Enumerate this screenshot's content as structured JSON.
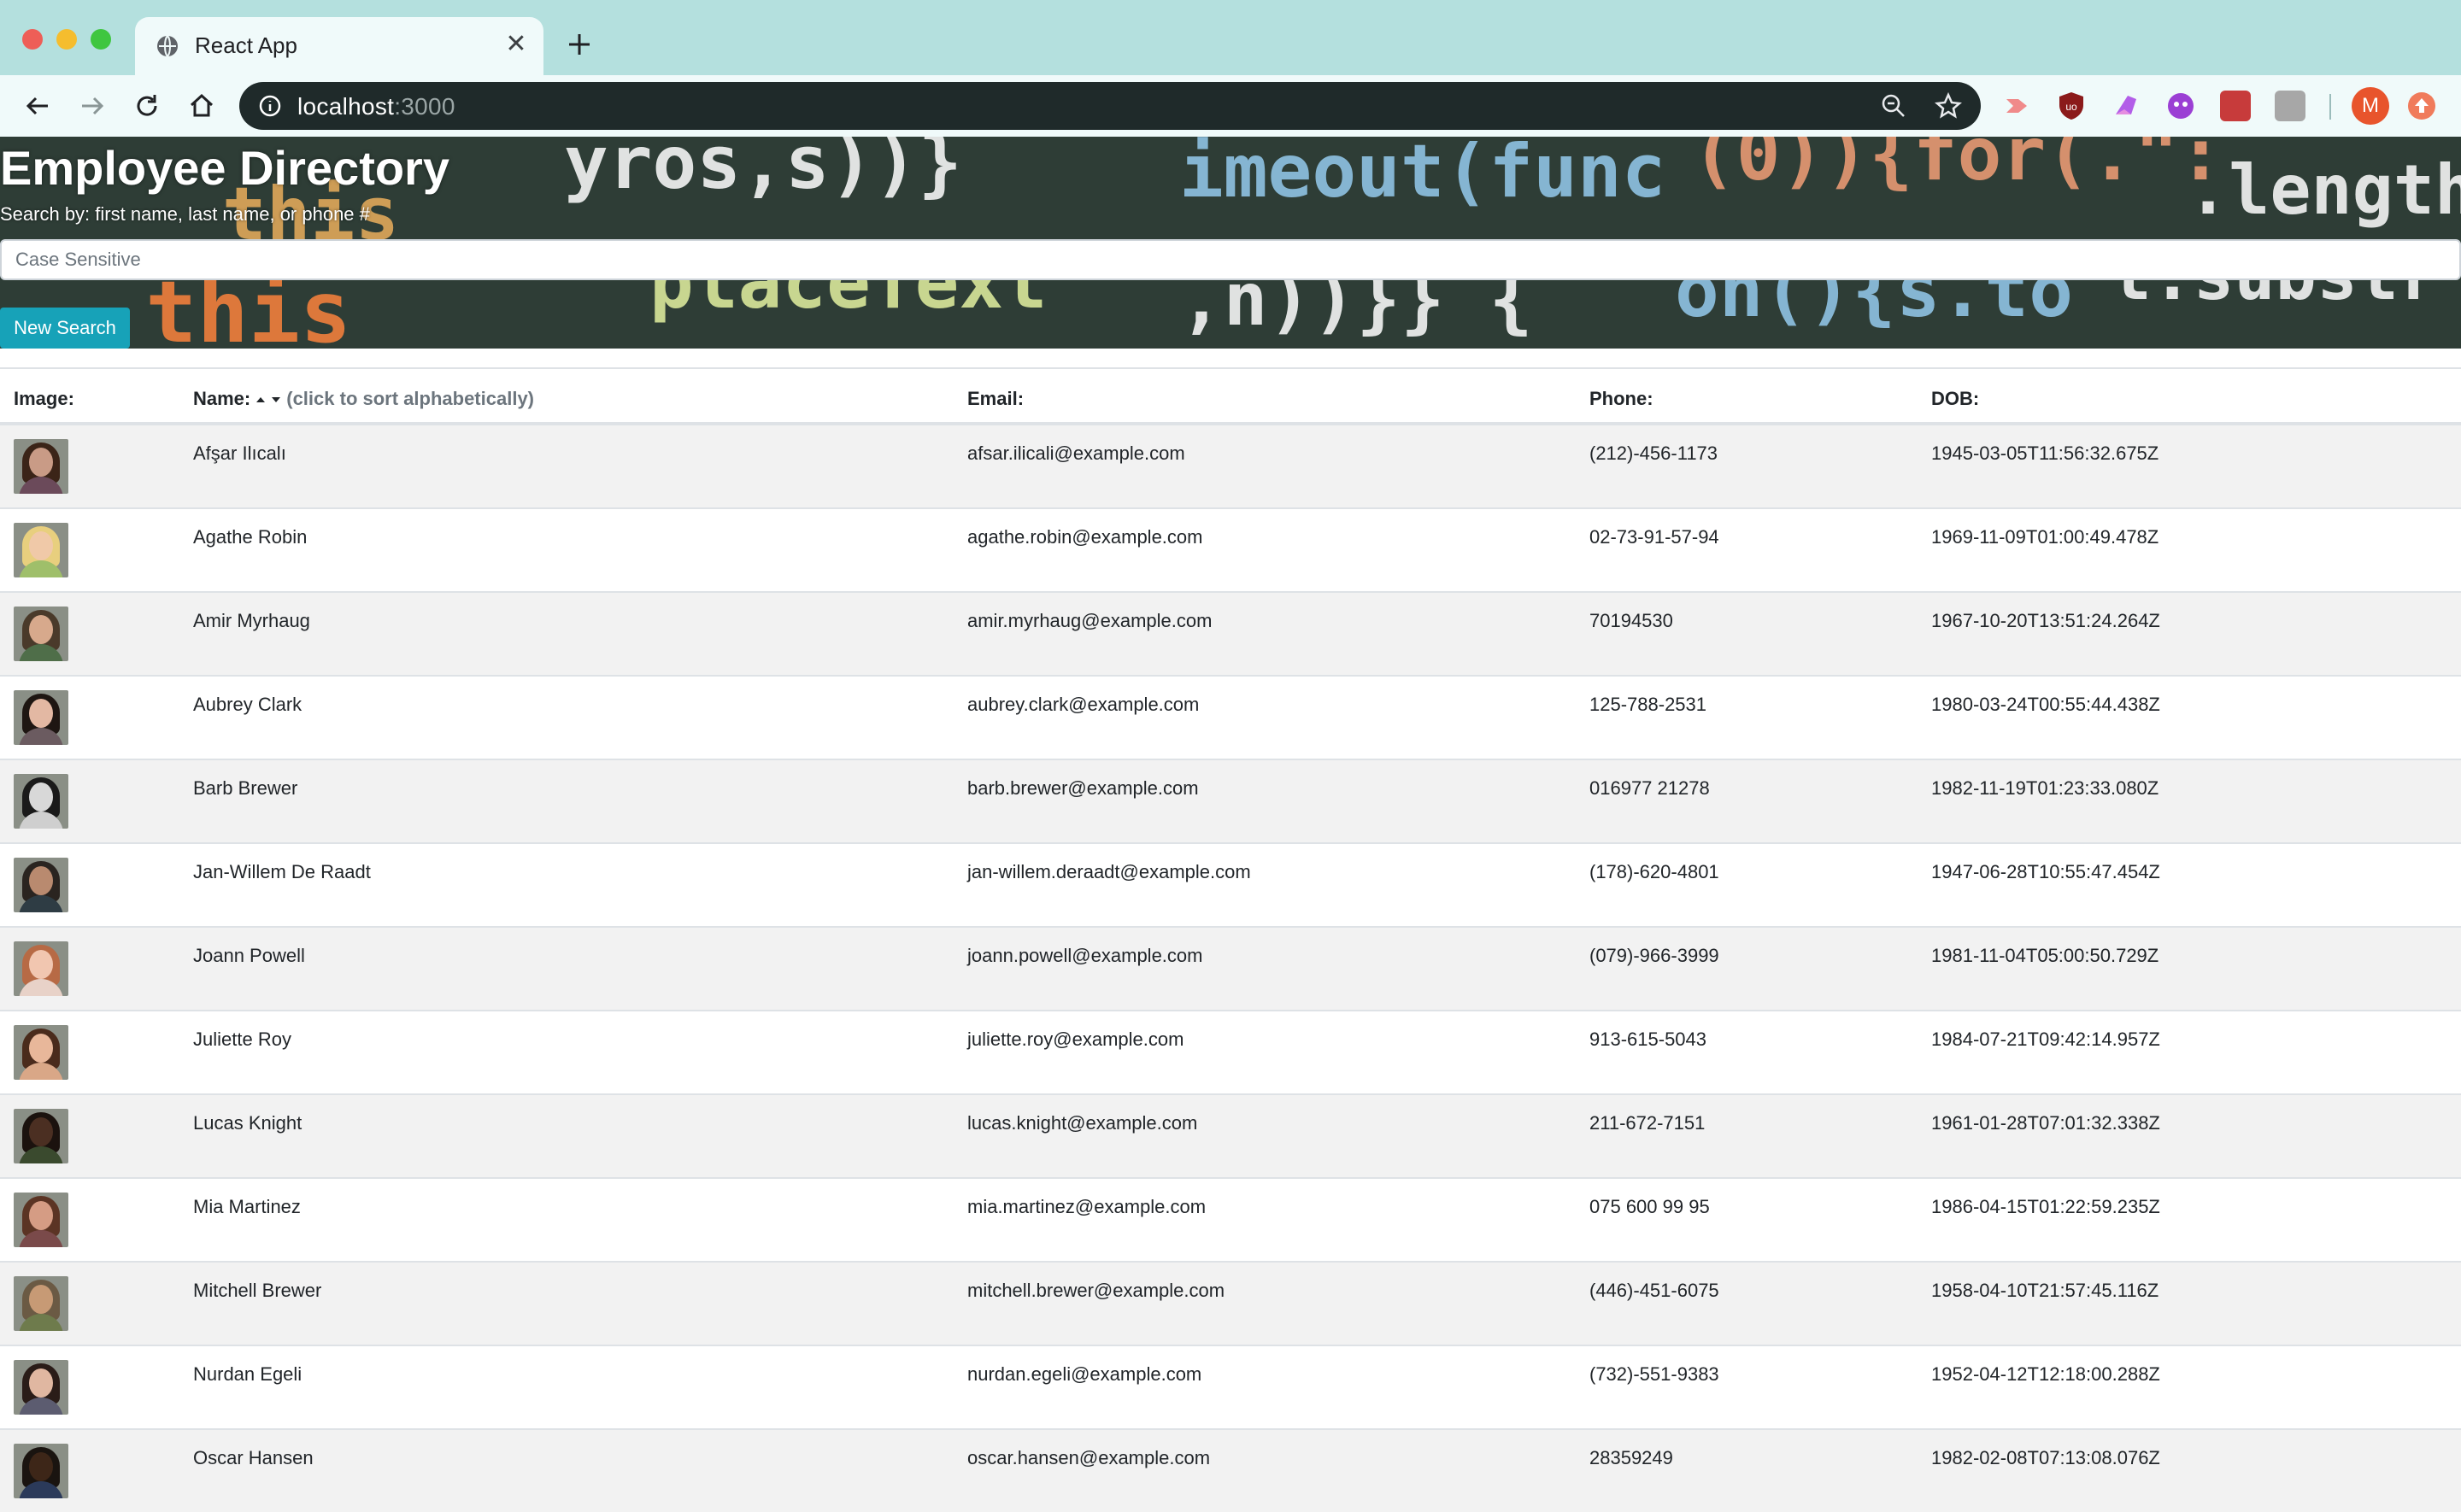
{
  "browser": {
    "tab_title": "React App",
    "url_host": "localhost",
    "url_port": ":3000",
    "profile_initial": "M",
    "accent": "#b4e0de"
  },
  "hero": {
    "title": "Employee Directory",
    "subtitle": "Search by: first name, last name, or phone #",
    "search_placeholder": "Case Sensitive",
    "button_label": "New Search",
    "button_color": "#17a2b8"
  },
  "table": {
    "headers": {
      "image": "Image:",
      "name": "Name:",
      "name_hint": "(click to sort alphabetically)",
      "email": "Email:",
      "phone": "Phone:",
      "dob": "DOB:"
    },
    "rows": [
      {
        "name": "Afşar Ilıcalı",
        "email": "afsar.ilicali@example.com",
        "phone": "(212)-456-1173",
        "dob": "1945-03-05T11:56:32.675Z",
        "skin": "#c99b86",
        "hair": "#3b2418",
        "shirt": "#6b4a5a"
      },
      {
        "name": "Agathe Robin",
        "email": "agathe.robin@example.com",
        "phone": "02-73-91-57-94",
        "dob": "1969-11-09T01:00:49.478Z",
        "skin": "#f0c9a8",
        "hair": "#e8cf7e",
        "shirt": "#9fbf6a"
      },
      {
        "name": "Amir Myrhaug",
        "email": "amir.myrhaug@example.com",
        "phone": "70194530",
        "dob": "1967-10-20T13:51:24.264Z",
        "skin": "#d7a98c",
        "hair": "#4a3a2a",
        "shirt": "#4f6e49"
      },
      {
        "name": "Aubrey Clark",
        "email": "aubrey.clark@example.com",
        "phone": "125-788-2531",
        "dob": "1980-03-24T00:55:44.438Z",
        "skin": "#e3b8a3",
        "hair": "#1e1612",
        "shirt": "#6b5b60"
      },
      {
        "name": "Barb Brewer",
        "email": "barb.brewer@example.com",
        "phone": "016977 21278",
        "dob": "1982-11-19T01:23:33.080Z",
        "skin": "#d8d8d8",
        "hair": "#1a1a1a",
        "shirt": "#cfcfcf"
      },
      {
        "name": "Jan-Willem De Raadt",
        "email": "jan-willem.deraadt@example.com",
        "phone": "(178)-620-4801",
        "dob": "1947-06-28T10:55:47.454Z",
        "skin": "#b98a6f",
        "hair": "#2a2420",
        "shirt": "#2e3c44"
      },
      {
        "name": "Joann Powell",
        "email": "joann.powell@example.com",
        "phone": "(079)-966-3999",
        "dob": "1981-11-04T05:00:50.729Z",
        "skin": "#f1c6b0",
        "hair": "#b76a45",
        "shirt": "#e8d2c8"
      },
      {
        "name": "Juliette Roy",
        "email": "juliette.roy@example.com",
        "phone": "913-615-5043",
        "dob": "1984-07-21T09:42:14.957Z",
        "skin": "#e8b79a",
        "hair": "#4a2b1c",
        "shirt": "#d9a787"
      },
      {
        "name": "Lucas Knight",
        "email": "lucas.knight@example.com",
        "phone": "211-672-7151",
        "dob": "1961-01-28T07:01:32.338Z",
        "skin": "#4b2f22",
        "hair": "#1b120e",
        "shirt": "#3a4a2e"
      },
      {
        "name": "Mia Martinez",
        "email": "mia.martinez@example.com",
        "phone": "075 600 99 95",
        "dob": "1986-04-15T01:22:59.235Z",
        "skin": "#d59c84",
        "hair": "#5b3424",
        "shirt": "#7a4a4a"
      },
      {
        "name": "Mitchell Brewer",
        "email": "mitchell.brewer@example.com",
        "phone": "(446)-451-6075",
        "dob": "1958-04-10T21:57:45.116Z",
        "skin": "#c79a75",
        "hair": "#6b5a44",
        "shirt": "#6e7b4c"
      },
      {
        "name": "Nurdan Egeli",
        "email": "nurdan.egeli@example.com",
        "phone": "(732)-551-9383",
        "dob": "1952-04-12T12:18:00.288Z",
        "skin": "#e0b7a1",
        "hair": "#2a1c18",
        "shirt": "#5c5c70"
      },
      {
        "name": "Oscar Hansen",
        "email": "oscar.hansen@example.com",
        "phone": "28359249",
        "dob": "1982-02-08T07:13:08.076Z",
        "skin": "#3d2618",
        "hair": "#1a1410",
        "shirt": "#2b3a5a"
      }
    ]
  }
}
